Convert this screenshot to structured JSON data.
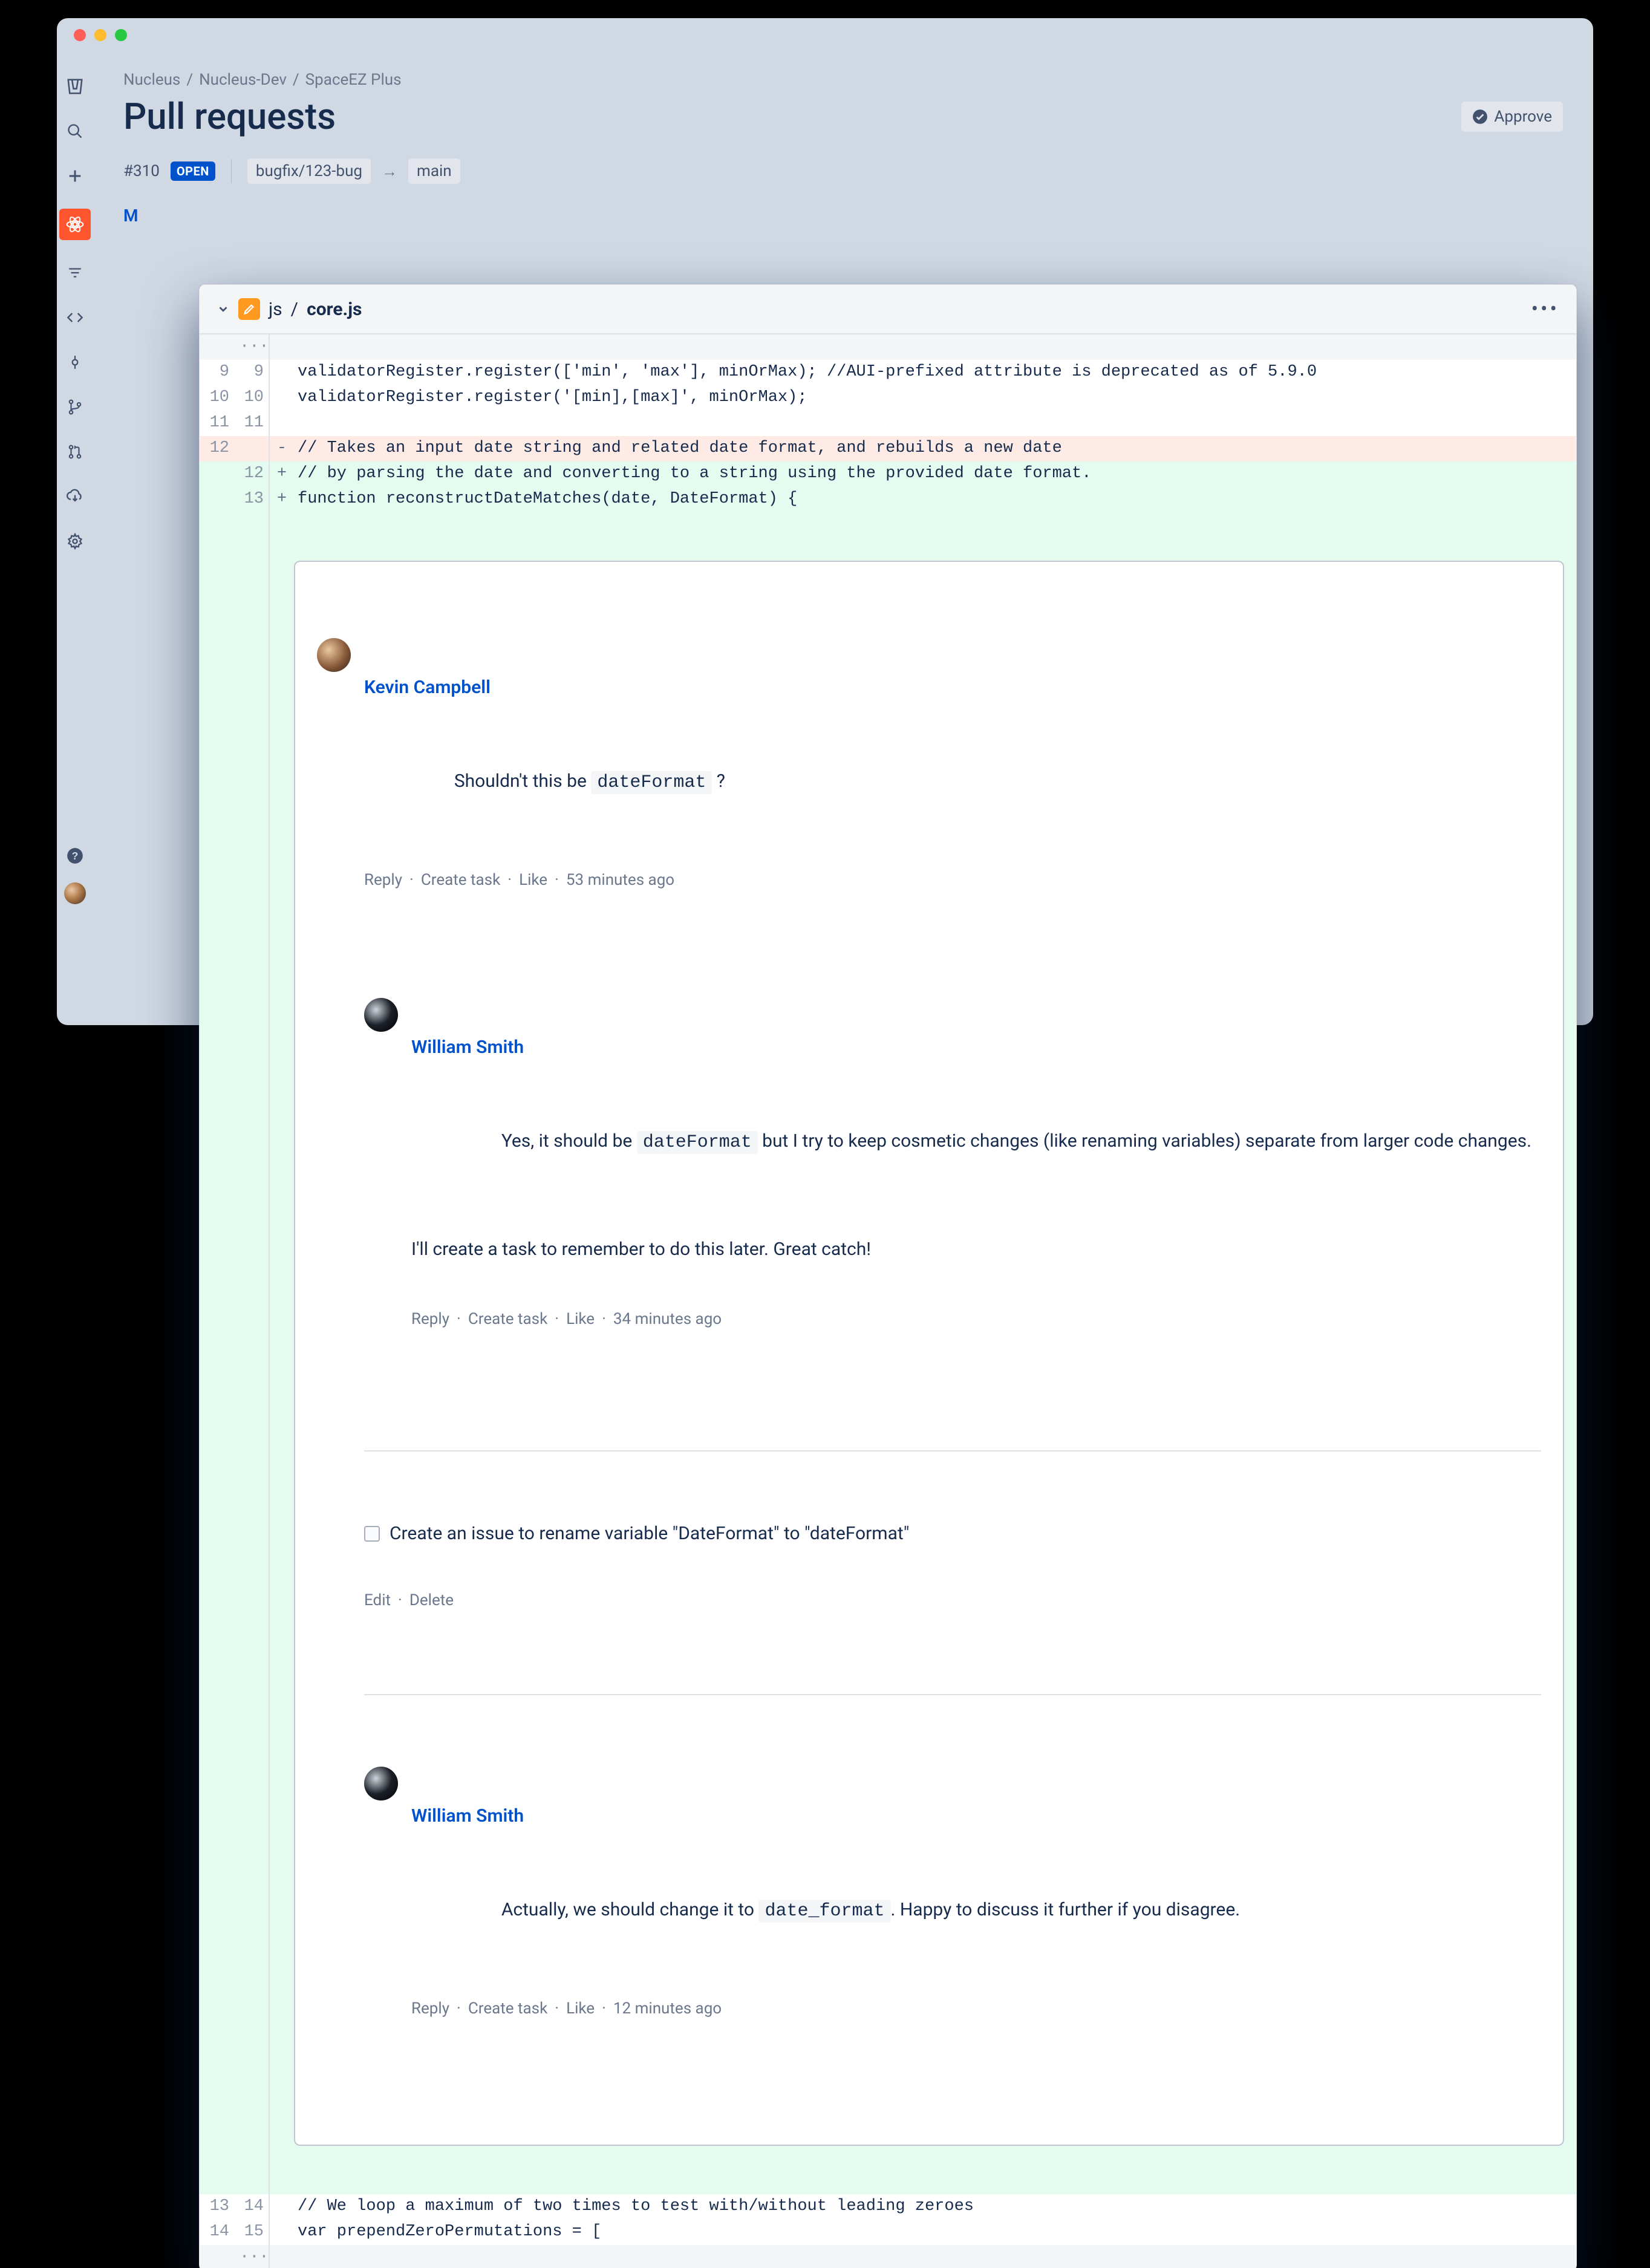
{
  "breadcrumb": [
    "Nucleus",
    "Nucleus-Dev",
    "SpaceEZ Plus"
  ],
  "page_title": "Pull requests",
  "approve_label": "Approve",
  "pr": {
    "id_label": "#310",
    "state_label": "OPEN",
    "source_branch": "bugfix/123-bug",
    "target_branch": "main"
  },
  "tab_hint": "M",
  "file": {
    "dir": "js",
    "name": "core.js"
  },
  "code_lines": {
    "l9": "validatorRegister.register(['min', 'max'], minOrMax); //AUI-prefixed attribute is deprecated as of 5.9.0",
    "l10": "validatorRegister.register('[min],[max]', minOrMax);",
    "l11": "",
    "l12_del": "// Takes an input date string and related date format, and rebuilds a new date",
    "l12_add": "// by parsing the date and converting to a string using the provided date format.",
    "l13_add": "function reconstructDateMatches(date, DateFormat) {",
    "l13_ctx": "// We loop a maximum of two times to test with/without leading zeroes",
    "l14_ctx": "var prependZeroPermutations = ["
  },
  "gutters": {
    "g9a": "9",
    "g9b": "9",
    "g10a": "10",
    "g10b": "10",
    "g11a": "11",
    "g11b": "11",
    "g12a": "12",
    "g12b_add": "12",
    "g13b_add": "13",
    "g13a_ctx": "13",
    "g14b_ctx": "14",
    "g14a_ctx": "14",
    "g15b_ctx": "15"
  },
  "comments": {
    "c1": {
      "author": "Kevin Campbell",
      "body_pre": "Shouldn't this be ",
      "code": "dateFormat",
      "body_post": " ?",
      "actions": {
        "reply": "Reply",
        "task": "Create task",
        "like": "Like",
        "time": "53 minutes ago"
      }
    },
    "c2": {
      "author": "William Smith",
      "line1_pre": "Yes, it should be ",
      "line1_code": "dateFormat",
      "line1_post": " but I try to keep cosmetic changes (like renaming variables) separate from larger code changes.",
      "line2": "I'll create a task to remember to do this later. Great catch!",
      "actions": {
        "reply": "Reply",
        "task": "Create task",
        "like": "Like",
        "time": "34 minutes ago"
      }
    },
    "task": {
      "text": "Create an issue to rename variable \"DateFormat\" to \"dateFormat\"",
      "edit": "Edit",
      "delete": "Delete"
    },
    "c3": {
      "author": "William Smith",
      "body_pre": "Actually, we should change it to ",
      "code": "date_format",
      "body_post": ". Happy to discuss it further if you disagree.",
      "actions": {
        "reply": "Reply",
        "task": "Create task",
        "like": "Like",
        "time": "12 minutes ago"
      }
    }
  },
  "fold": "···"
}
